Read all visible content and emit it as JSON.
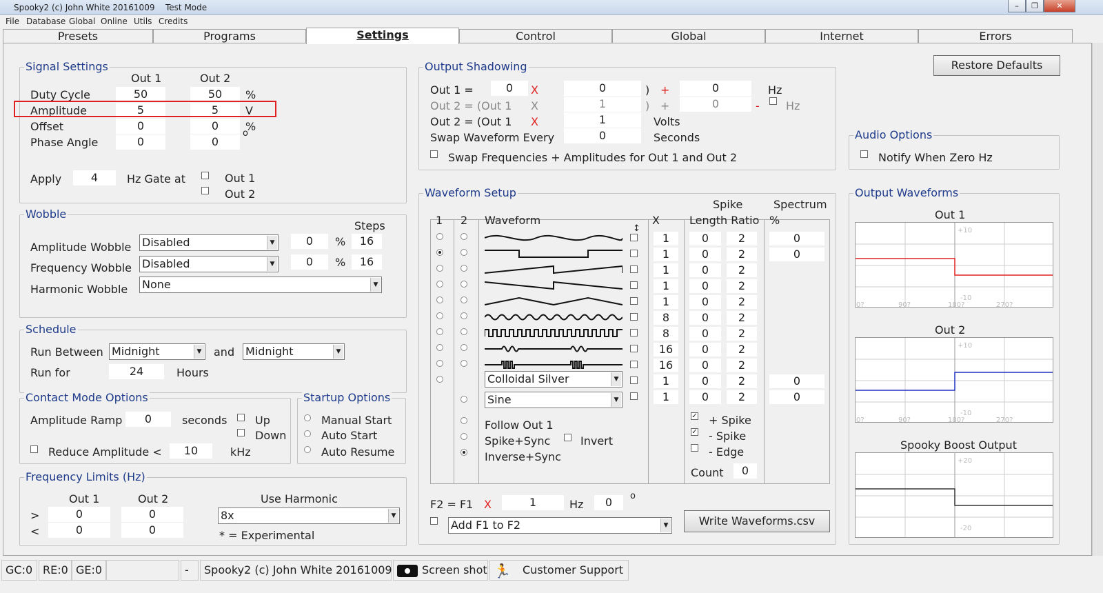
{
  "window": {
    "title": "Spooky2 (c) John White 20161009",
    "mode": "Test Mode",
    "min": "–",
    "restore": "❐",
    "close": "✕"
  },
  "menu": [
    "File",
    "Database",
    "Global",
    "Online",
    "Utils",
    "Credits"
  ],
  "tabs": [
    "Presets",
    "Programs",
    "Settings",
    "Control",
    "Global",
    "Internet",
    "Errors"
  ],
  "signal": {
    "title": "Signal Settings",
    "out1": "Out 1",
    "out2": "Out 2",
    "rows": [
      {
        "label": "Duty Cycle",
        "v1": "50",
        "v2": "50",
        "unit": "%"
      },
      {
        "label": "Amplitude",
        "v1": "5",
        "v2": "5",
        "unit": "V"
      },
      {
        "label": "Offset",
        "v1": "0",
        "v2": "0",
        "unit": "%"
      },
      {
        "label": "Phase Angle",
        "v1": "0",
        "v2": "0",
        "unit": "o"
      }
    ],
    "apply": "Apply",
    "gate_value": "4",
    "gate_label": "Hz Gate at",
    "gate_out1": "Out 1",
    "gate_out2": "Out 2"
  },
  "wobble": {
    "title": "Wobble",
    "steps": "Steps",
    "amp": {
      "label": "Amplitude Wobble",
      "select": "Disabled",
      "value": "0",
      "pct": "%",
      "steps": "16"
    },
    "freq": {
      "label": "Frequency Wobble",
      "select": "Disabled",
      "value": "0",
      "pct": "%",
      "steps": "16"
    },
    "harm": {
      "label": "Harmonic Wobble",
      "select": "None"
    }
  },
  "schedule": {
    "title": "Schedule",
    "run_between": "Run Between",
    "from": "Midnight",
    "and": "and",
    "to": "Midnight",
    "run_for": "Run for",
    "hours_value": "24",
    "hours": "Hours"
  },
  "contact": {
    "title": "Contact Mode Options",
    "ramp": "Amplitude Ramp",
    "ramp_value": "0",
    "seconds": "seconds",
    "up": "Up",
    "down": "Down",
    "reduce": "Reduce Amplitude <",
    "reduce_value": "10",
    "khz": "kHz"
  },
  "startup": {
    "title": "Startup Options",
    "manual": "Manual Start",
    "auto": "Auto Start",
    "resume": "Auto Resume"
  },
  "freqlimits": {
    "title": "Frequency Limits (Hz)",
    "out1": "Out 1",
    "out2": "Out 2",
    "use_harmonic": "Use Harmonic",
    "gt": ">",
    "lt": "<",
    "gt1": "0",
    "gt2": "0",
    "lt1": "0",
    "lt2": "0",
    "harmonic": "8x",
    "note": "* = Experimental"
  },
  "shadow": {
    "title": "Output Shadowing",
    "r1": {
      "label": "Out 1 =",
      "a": "0",
      "x": "X",
      "b": "0",
      "paren": ")",
      "plus": "+",
      "c": "0",
      "unit": "Hz"
    },
    "r2": {
      "label": "Out 2 = (Out 1",
      "x": "X",
      "b": "1",
      "paren": ")",
      "plus": "+",
      "c": "0",
      "minus": "-",
      "unit": "Hz"
    },
    "r3": {
      "label": "Out 2 = (Out 1",
      "x": "X",
      "b": "1",
      "unit": "Volts"
    },
    "r4": {
      "label": "Swap Waveform Every",
      "b": "0",
      "unit": "Seconds"
    },
    "swap": "Swap Frequencies + Amplitudes for Out 1 and Out 2"
  },
  "restore": "Restore Defaults",
  "audio": {
    "title": "Audio Options",
    "notify": "Notify When Zero Hz"
  },
  "waveform": {
    "title": "Waveform Setup",
    "c1": "1",
    "c2": "2",
    "cwave": "Waveform",
    "cx": "X",
    "spike": "Spike",
    "lenratio": "Length Ratio",
    "spectrum": "Spectrum",
    "pct": "%",
    "rows": [
      {
        "x": "1",
        "l": "0",
        "r": "2",
        "s": "0"
      },
      {
        "x": "1",
        "l": "0",
        "r": "2",
        "s": "0"
      },
      {
        "x": "1",
        "l": "0",
        "r": "2",
        "s": ""
      },
      {
        "x": "1",
        "l": "0",
        "r": "2",
        "s": ""
      },
      {
        "x": "1",
        "l": "0",
        "r": "2",
        "s": ""
      },
      {
        "x": "8",
        "l": "0",
        "r": "2",
        "s": ""
      },
      {
        "x": "8",
        "l": "0",
        "r": "2",
        "s": ""
      },
      {
        "x": "16",
        "l": "0",
        "r": "2",
        "s": ""
      },
      {
        "x": "16",
        "l": "0",
        "r": "2",
        "s": ""
      },
      {
        "x": "1",
        "l": "0",
        "r": "2",
        "s": "0"
      },
      {
        "x": "1",
        "l": "0",
        "r": "2",
        "s": "0"
      }
    ],
    "sel10": "Colloidal Silver",
    "sel11": "Sine",
    "follow": "Follow Out 1",
    "spikesync": "Spike+Sync",
    "invert": "Invert",
    "inversesync": "Inverse+Sync",
    "plus_spike": "+ Spike",
    "minus_spike": "- Spike",
    "minus_edge": "- Edge",
    "count": "Count",
    "count_value": "0",
    "f2": "F2 = F1",
    "f2x": "X",
    "f2val": "1",
    "hz": "Hz",
    "phase": "0",
    "deg": "o",
    "addf1": "Add F1 to F2",
    "write": "Write Waveforms.csv"
  },
  "outwave": {
    "title": "Output Waveforms",
    "out1": "Out 1",
    "out2": "Out 2",
    "boost": "Spooky Boost Output",
    "t10": "+10",
    "b10": "-10",
    "t20": "+20",
    "b20": "-20",
    "ticks": [
      "0?",
      "90?",
      "180?",
      "270?"
    ]
  },
  "status": {
    "gc": "GC:0",
    "re": "RE:0",
    "ge": "GE:0",
    "empty": "",
    "dash": "-",
    "title": "Spooky2 (c) John White 20161009",
    "screenshot": "Screen shot",
    "support": "Customer Support"
  }
}
